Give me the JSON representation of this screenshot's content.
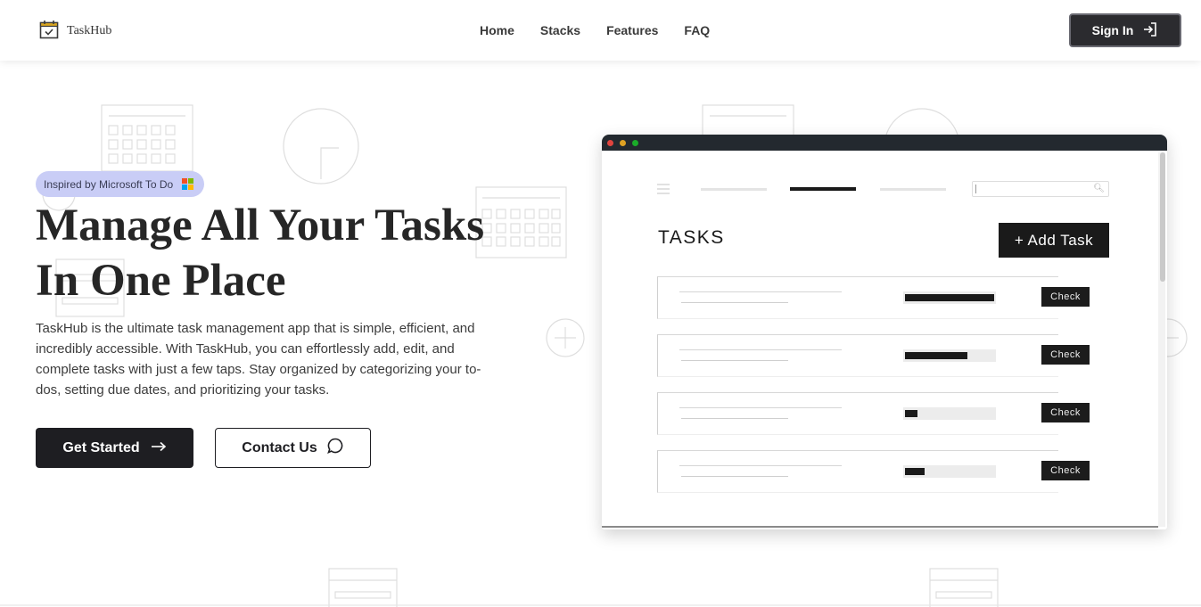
{
  "brand": {
    "name": "TaskHub",
    "logo_icon": "calendar-check-icon"
  },
  "nav": {
    "items": [
      "Home",
      "Stacks",
      "Features",
      "FAQ"
    ]
  },
  "signin": {
    "label": "Sign In",
    "icon": "sign-in-icon"
  },
  "hero": {
    "badge": "Inspired by Microsoft To Do",
    "title_line1": "Manage All Your Tasks",
    "title_line2": "In One Place",
    "description": "TaskHub is the ultimate task management app that is simple, efficient, and incredibly accessible. With TaskHub, you can effortlessly add, edit, and complete tasks with just a few taps. Stay organized by categorizing your to-dos, setting due dates, and prioritizing your tasks.",
    "primary_button": "Get Started",
    "secondary_button": "Contact Us"
  },
  "mockup": {
    "title": "TASKS",
    "add_button": "+ Add Task",
    "tasks": [
      {
        "check": "Check",
        "progress": 1.0
      },
      {
        "check": "Check",
        "progress": 0.7
      },
      {
        "check": "Check",
        "progress": 0.14
      },
      {
        "check": "Check",
        "progress": 0.22
      }
    ]
  },
  "colors": {
    "accent_dark": "#1e1e22",
    "badge_bg": "#c9cdf6",
    "browser_bar": "#23292f",
    "dot_red": "#e0443e",
    "dot_yellow": "#dea123",
    "dot_green": "#1aab29"
  }
}
